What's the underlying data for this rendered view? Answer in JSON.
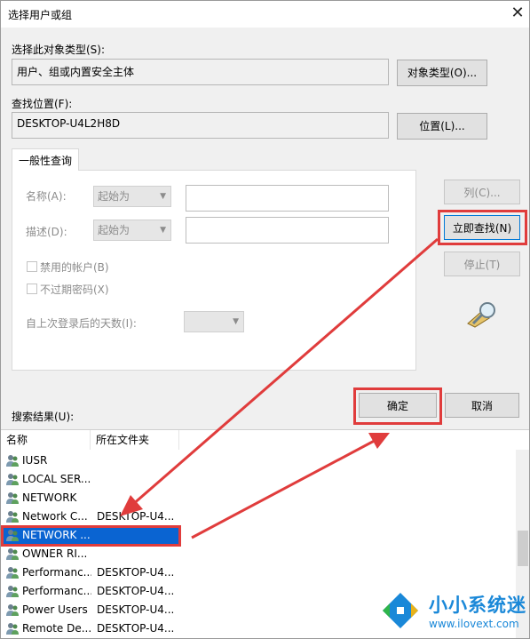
{
  "window": {
    "title": "选择用户或组",
    "close_glyph": "✕"
  },
  "object_type": {
    "label": "选择此对象类型(S):",
    "value": "用户、组或内置安全主体",
    "button": "对象类型(O)..."
  },
  "location": {
    "label": "查找位置(F):",
    "value": "DESKTOP-U4L2H8D",
    "button": "位置(L)..."
  },
  "tab": {
    "label": "一般性查询"
  },
  "query": {
    "name_label": "名称(A):",
    "name_mode": "起始为",
    "desc_label": "描述(D):",
    "desc_mode": "起始为",
    "disabled_accounts": "禁用的帐户(B)",
    "non_expiring_pw": "不过期密码(X)",
    "days_label": "自上次登录后的天数(I):"
  },
  "side_buttons": {
    "columns": "列(C)...",
    "find_now": "立即查找(N)",
    "stop": "停止(T)"
  },
  "footer": {
    "results_label": "搜索结果(U):",
    "ok": "确定",
    "cancel": "取消"
  },
  "results": {
    "headers": [
      "名称",
      "所在文件夹"
    ],
    "rows": [
      {
        "name": "IUSR",
        "folder": ""
      },
      {
        "name": "LOCAL SER...",
        "folder": ""
      },
      {
        "name": "NETWORK",
        "folder": ""
      },
      {
        "name": "Network C...",
        "folder": "DESKTOP-U4..."
      },
      {
        "name": "NETWORK ...",
        "folder": "",
        "selected": true
      },
      {
        "name": "OWNER RI...",
        "folder": ""
      },
      {
        "name": "Performanc...",
        "folder": "DESKTOP-U4..."
      },
      {
        "name": "Performanc...",
        "folder": "DESKTOP-U4..."
      },
      {
        "name": "Power Users",
        "folder": "DESKTOP-U4..."
      },
      {
        "name": "Remote De...",
        "folder": "DESKTOP-U4..."
      }
    ]
  },
  "watermark": {
    "title": "小小系统迷",
    "url": "www.ilovext.com"
  },
  "colors": {
    "highlight": "#e03c3c",
    "selection": "#0a64d2",
    "watermark": "#1a88d8"
  }
}
